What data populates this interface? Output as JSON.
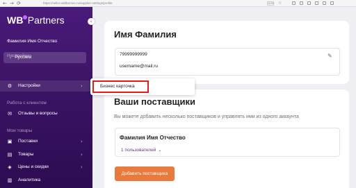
{
  "browser": {
    "url": "https://seller.wildberries.ru/supplier-settings/profile",
    "zoom": "110%",
    "nav_back": "←",
    "nav_forward": "→",
    "nav_reload": "⟳",
    "star": "☆"
  },
  "sidebar": {
    "logo_wb": "WB",
    "logo_partners": "Partners",
    "collapse_glyph": "‹",
    "user_name": "Фамилия Имя Отчество",
    "language": "Русский",
    "section_settings": "Настройки",
    "section_clients": "Работа с клиентом",
    "section_goods": "Мои товары",
    "items": [
      {
        "label": "Настройки",
        "icon": "sliders-icon",
        "glyph": "⚙"
      },
      {
        "label": "Отзывы и вопросы",
        "icon": "chat-icon",
        "glyph": "✉"
      },
      {
        "label": "Поставки",
        "icon": "box-icon",
        "glyph": "▣"
      },
      {
        "label": "Товары",
        "icon": "tag-icon",
        "glyph": "▤"
      },
      {
        "label": "Цены и скидки",
        "icon": "price-tag-icon",
        "glyph": "◈"
      },
      {
        "label": "Аналитика",
        "icon": "chart-icon",
        "glyph": "▥"
      }
    ]
  },
  "tooltip": {
    "item": "Бизнес карточка"
  },
  "profile": {
    "title": "Имя Фамилия",
    "phone": "79999999999",
    "email": "username@mail.ru"
  },
  "suppliers": {
    "title": "Ваши поставщики",
    "subtitle": "Вы можете добавить несколько поставщиков и управлять ими из одного аккаунта",
    "supplier_name": "Фамилия Имя Отчество",
    "users": "1 пользователей",
    "add_button": "Добавить поставщика"
  },
  "colors": {
    "sidebar": "#3d1466",
    "accent_button": "#e87a3e",
    "highlight": "#e31b1b"
  }
}
